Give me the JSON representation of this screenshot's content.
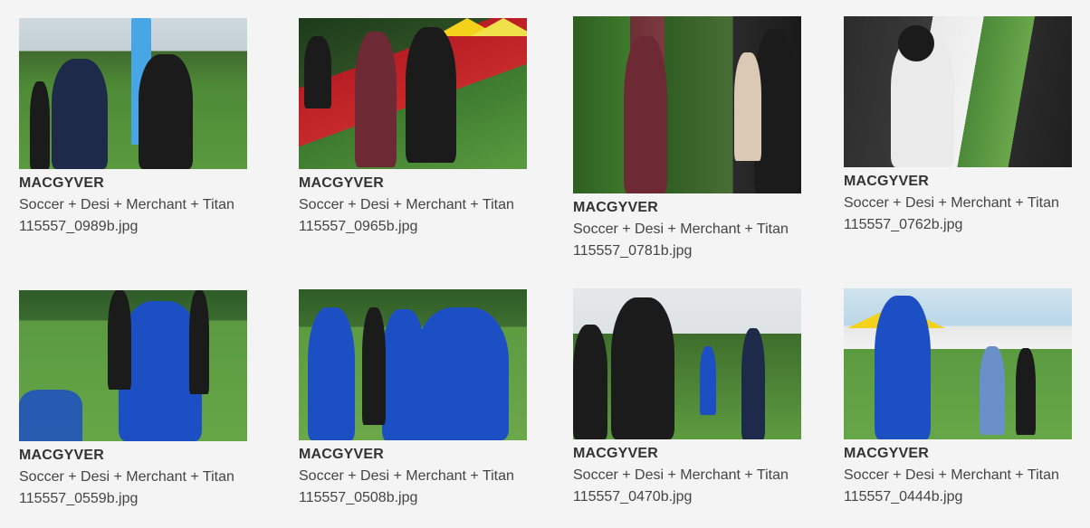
{
  "gallery": {
    "items": [
      {
        "title": "MACGYVER",
        "description": "Soccer + Desi + Merchant + Titan",
        "filename": "115557_0989b.jpg",
        "image_alt": "Man in navy suit and photographer with camera at soccer field"
      },
      {
        "title": "MACGYVER",
        "description": "Soccer + Desi + Merchant + Titan",
        "filename": "115557_0965b.jpg",
        "image_alt": "Man in maroon suit walking on red carpet"
      },
      {
        "title": "MACGYVER",
        "description": "Soccer + Desi + Merchant + Titan",
        "filename": "115557_0781b.jpg",
        "image_alt": "Man in maroon suit standing by hedge"
      },
      {
        "title": "MACGYVER",
        "description": "Soccer + Desi + Merchant + Titan",
        "filename": "115557_0762b.jpg",
        "image_alt": "Woman in white shirt driving van"
      },
      {
        "title": "MACGYVER",
        "description": "Soccer + Desi + Merchant + Titan",
        "filename": "115557_0559b.jpg",
        "image_alt": "Soccer player in blue jersey on field"
      },
      {
        "title": "MACGYVER",
        "description": "Soccer + Desi + Merchant + Titan",
        "filename": "115557_0508b.jpg",
        "image_alt": "Soccer players in blue jerseys walking"
      },
      {
        "title": "MACGYVER",
        "description": "Soccer + Desi + Merchant + Titan",
        "filename": "115557_0470b.jpg",
        "image_alt": "Photographer with camera on soccer field"
      },
      {
        "title": "MACGYVER",
        "description": "Soccer + Desi + Merchant + Titan",
        "filename": "115557_0444b.jpg",
        "image_alt": "Soccer player in blue jersey near tents"
      }
    ]
  }
}
